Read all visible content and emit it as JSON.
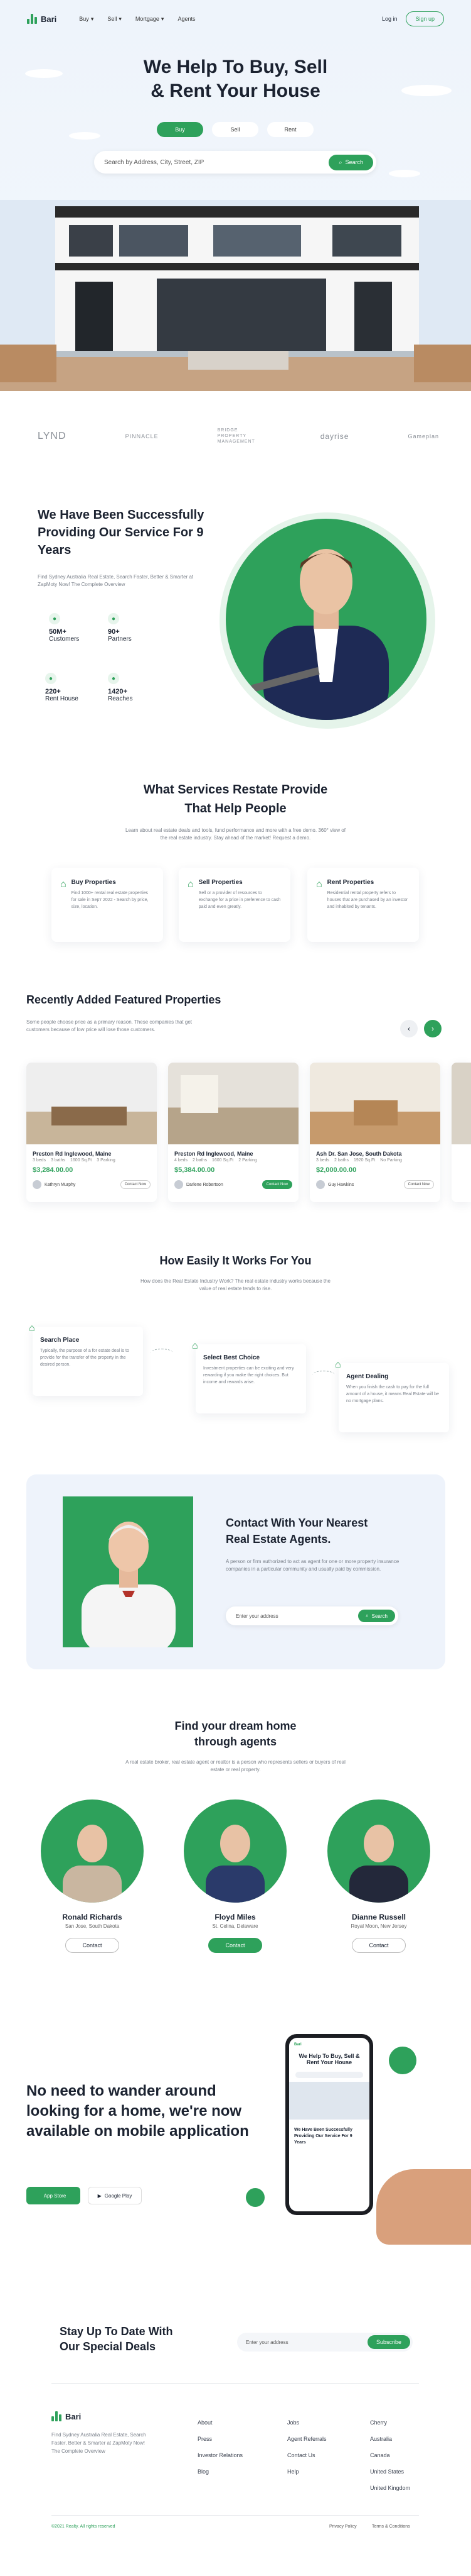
{
  "nav": {
    "brand": "Bari",
    "links": [
      "Buy",
      "Sell",
      "Mortgage",
      "Agents"
    ],
    "login": "Log in",
    "signup": "Sign up"
  },
  "hero": {
    "title_line1": "We Help To Buy, Sell",
    "title_line2": "& Rent Your House",
    "tabs": [
      "Buy",
      "Sell",
      "Rent"
    ],
    "active_tab": "Buy",
    "search_placeholder": "Search by Address, City, Street, ZIP",
    "search_button": "Search"
  },
  "brands": [
    "LYND",
    "PINNACLE",
    "BRIDGE PROPERTY MANAGEMENT",
    "dayrise",
    "Gameplan"
  ],
  "about": {
    "title": "We Have Been Successfully Providing Our Service For 9 Years",
    "text": "Find Sydney Australia Real Estate, Search Faster, Better & Smarter at ZapMoty Now! The Complete Overview",
    "stats": [
      {
        "value": "50M+",
        "label": "Customers"
      },
      {
        "value": "90+",
        "label": "Partners"
      },
      {
        "value": "220+",
        "label": "Rent House"
      },
      {
        "value": "1420+",
        "label": "Reaches"
      }
    ]
  },
  "services": {
    "title_line1": "What Services Restate Provide",
    "title_line2": "That Help People",
    "text": "Learn about real estate deals and tools, fund performance and more with a free demo. 360° view of the real estate industry. Stay ahead of the market! Request a demo.",
    "items": [
      {
        "title": "Buy Properties",
        "text": "Find 1000+ rental real estate properties for sale in Sep'r 2022 - Search by price, size, location."
      },
      {
        "title": "Sell Properties",
        "text": "Sell or a provider of resources to exchange for a price in preference to cash paid and even greatly."
      },
      {
        "title": "Rent Properties",
        "text": "Residential rental property refers to houses that are purchased by an investor and inhabited by tenants."
      }
    ]
  },
  "featured": {
    "title": "Recently Added Featured Properties",
    "text": "Some people choose price as a primary reason. These companies that get customers because of low price will lose those customers.",
    "props": [
      {
        "title": "Preston Rd Inglewood, Maine",
        "meta": [
          "3 beds",
          "3 baths",
          "1600 Sq.Ft",
          "3 Parking"
        ],
        "price": "$3,284.00.00",
        "agent": "Kathryn Murphy",
        "btn": "Contact Now"
      },
      {
        "title": "Preston Rd Inglewood, Maine",
        "meta": [
          "4 beds",
          "2 baths",
          "1600 Sq.Ft",
          "2 Parking"
        ],
        "price": "$5,384.00.00",
        "agent": "Darlene Robertson",
        "btn": "Contact Now"
      },
      {
        "title": "Ash Dr. San Jose, South Dakota",
        "meta": [
          "3 beds",
          "2 baths",
          "1920 Sq.Ft",
          "No Parking"
        ],
        "price": "$2,000.00.00",
        "agent": "Guy Hawkins",
        "btn": "Contact Now"
      }
    ]
  },
  "how": {
    "title": "How Easily It Works For You",
    "text": "How does the Real Estate Industry Work? The real estate industry works because the value of real estate tends to rise.",
    "steps": [
      {
        "title": "Search Place",
        "text": "Typically, the purpose of a for estate deal is to provide for the transfer of the property in the desired person."
      },
      {
        "title": "Select Best Choice",
        "text": "Investment properties can be exciting and very rewarding if you make the right choices. But income and rewards arise."
      },
      {
        "title": "Agent Dealing",
        "text": "When you finish the cash to pay for the full amount of a house, it means Real Estate will be no mortgage plans."
      }
    ]
  },
  "contact": {
    "title_line1": "Contact With Your Nearest",
    "title_line2": "Real Estate Agents.",
    "text": "A person or firm authorized to act as agent for one or more property insurance companies in a particular community and usually paid by commission.",
    "placeholder": "Enter your address",
    "button": "Search"
  },
  "agents": {
    "title_line1": "Find your dream home",
    "title_line2": "through agents",
    "text": "A real estate broker, real estate agent or realtor is a person who represents sellers or buyers of real estate or real property.",
    "list": [
      {
        "name": "Ronald Richards",
        "addr": "San Jose, South Dakota",
        "btn": "Contact"
      },
      {
        "name": "Floyd Miles",
        "addr": "St. Celina, Delaware",
        "btn": "Contact"
      },
      {
        "name": "Dianne Russell",
        "addr": "Royal Moon, New Jersey",
        "btn": "Contact"
      }
    ]
  },
  "app": {
    "title": "No need to wander around looking for a home, we're now available on mobile application",
    "apple": "App Store",
    "google": "Google Play",
    "phone_title": "We Help To Buy, Sell & Rent Your House",
    "phone_sub": "We Have Been Successfully Providing Our Service For 9 Years"
  },
  "newsletter": {
    "title_line1": "Stay Up To Date With",
    "title_line2": "Our Special Deals",
    "placeholder": "Enter your address",
    "button": "Subscribe"
  },
  "footer": {
    "brand": "Bari",
    "about": "Find Sydney Australia Real Estate, Search Faster, Better & Smarter at ZapMoty Now! The Complete Overview",
    "col1": [
      "About",
      "Press",
      "Investor Relations",
      "Blog"
    ],
    "col2": [
      "Jobs",
      "Agent Referrals",
      "Contact Us",
      "Help"
    ],
    "col3": [
      "Cherry",
      "Australia",
      "Canada",
      "United States",
      "United Kingdom"
    ],
    "copyright": "©2021 Realty. All rights reserved",
    "privacy": "Privacy Policy",
    "terms": "Terms & Conditions"
  },
  "colors": {
    "accent": "#2ea15b"
  }
}
